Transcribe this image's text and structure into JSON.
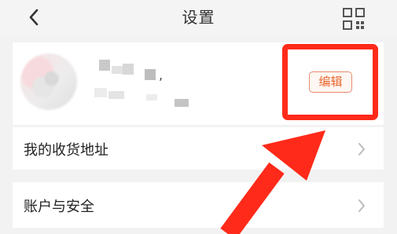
{
  "header": {
    "title": "设置",
    "back_icon": "chevron-left-icon",
    "right_icon": "qr-code-icon"
  },
  "profile": {
    "name_suffix": ",",
    "edit_label": "编辑",
    "avatar_blurred": true
  },
  "rows": [
    {
      "label": "我的收货地址",
      "icon": "chevron-right-icon"
    },
    {
      "label": "账户与安全",
      "icon": "chevron-right-icon"
    }
  ],
  "annotation": {
    "highlight_color": "#ff2a1a",
    "target": "edit-button"
  },
  "colors": {
    "background": "#f2f2f2",
    "accent": "#e8672f",
    "annotation": "#ff2a1a"
  }
}
